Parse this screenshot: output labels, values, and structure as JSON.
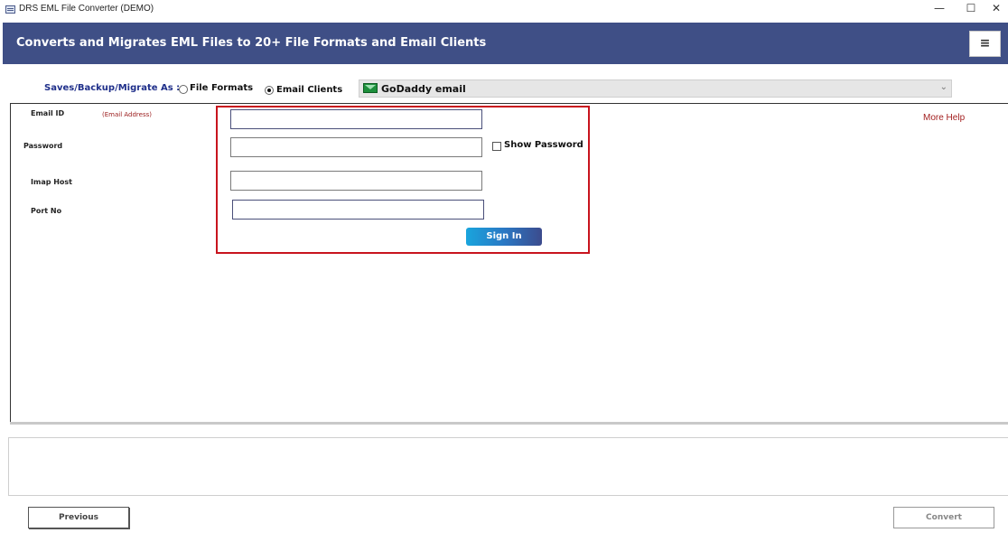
{
  "window": {
    "title": "DRS EML File Converter (DEMO)",
    "controls": {
      "minimize": "—",
      "maximize": "☐",
      "close": "✕"
    }
  },
  "banner": {
    "headline": "Converts and Migrates EML Files to 20+ File Formats and Email Clients",
    "menu_icon": "≡"
  },
  "options": {
    "label": "Saves/Backup/Migrate As :",
    "file_formats": "File Formats",
    "email_clients": "Email Clients",
    "selected": "email_clients",
    "client_select": "GoDaddy email",
    "client_icon": "green-mail-icon",
    "arrow": "⌄"
  },
  "form": {
    "email_label": "Email ID",
    "email_hint": "(Email Address)",
    "password_label": "Password",
    "imap_label": "Imap Host",
    "port_label": "Port No",
    "email_value": "",
    "password_value": "",
    "imap_value": "",
    "port_value": "",
    "show_password": "Show Password",
    "show_password_checked": false,
    "sign_in": "Sign In"
  },
  "more_help": "More Help",
  "footer": {
    "previous": "Previous",
    "convert": "Convert"
  },
  "colors": {
    "banner": "#3f4f86",
    "highlight_box": "#c8141e",
    "label_blue": "#1f2f8a",
    "help_red": "#a32020"
  }
}
